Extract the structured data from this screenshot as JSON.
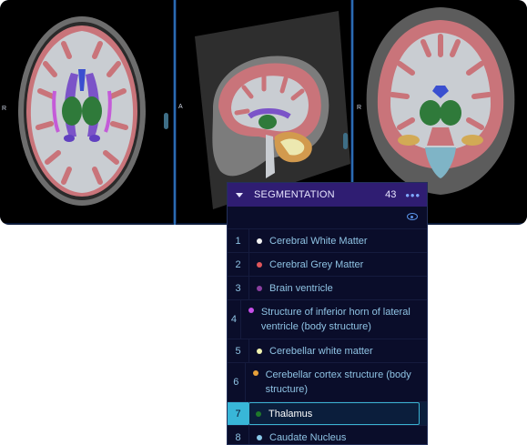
{
  "viewports": {
    "axial_orientation": "R",
    "sagittal_orientation": "A",
    "coronal_orientation": "R"
  },
  "segmentation_panel": {
    "title": "SEGMENTATION",
    "count": "43",
    "more_icon": "more-dots-icon",
    "visibility_icon": "eye-icon",
    "segments": [
      {
        "index": "1",
        "label": "Cerebral White Matter",
        "color": "#f2f2f2"
      },
      {
        "index": "2",
        "label": "Cerebral Grey Matter",
        "color": "#e0565b"
      },
      {
        "index": "3",
        "label": "Brain ventricle",
        "color": "#8b3fa0"
      },
      {
        "index": "4",
        "label": "Structure of inferior horn of lateral ventricle (body structure)",
        "color": "#c64fe8"
      },
      {
        "index": "5",
        "label": "Cerebellar white matter",
        "color": "#f0f2b0"
      },
      {
        "index": "6",
        "label": "Cerebellar cortex structure (body structure)",
        "color": "#e7a03a"
      },
      {
        "index": "7",
        "label": "Thalamus",
        "color": "#1f7a2a",
        "selected": true
      },
      {
        "index": "8",
        "label": "Caudate Nucleus",
        "color": "#88c8e8"
      }
    ]
  }
}
